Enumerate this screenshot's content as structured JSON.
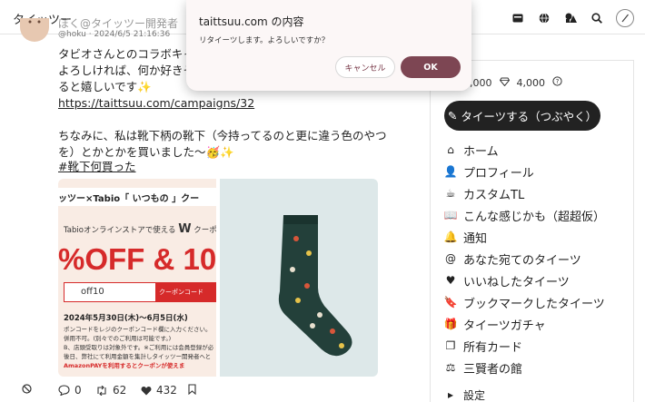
{
  "app": {
    "brand": "タイッツー"
  },
  "colors": {
    "dialog_ok": "#7d4653",
    "dialog_bg": "#fcf7f7",
    "primary_button": "#222222",
    "promo_red": "#d62a2a",
    "sock_panel": "#dde8e9"
  },
  "topbar": {
    "icons": [
      "card-icon",
      "globe-icon",
      "shapes-icon",
      "search-icon",
      "pen-icon"
    ]
  },
  "post": {
    "author": "ぼく@タイッツー開発者",
    "handle": "@hoku",
    "timestamp": "2024/6/5 21:16:36",
    "lines": [
      "タビオさんとのコラボキャン",
      "よろしければ、何か好きそ",
      "ると嬉しいです✨"
    ],
    "link": "https://taittsuu.com/campaigns/32",
    "lines2": [
      "ちなみに、私は靴下柄の靴下（今持ってるのと更に違う色のやつ",
      "を）とかとかを買いました〜🥳✨"
    ],
    "hashtag": "#靴下何買った"
  },
  "promo": {
    "strip": "ッツー×Tabio「 いつもの 」クー",
    "sub_prefix": "Tabioオンラインストアで使える",
    "sub_w": "W",
    "sub_suffix": "クーポン",
    "off_text": "%OFF & 10",
    "code": "off10",
    "tag": "クーポンコード",
    "date": "2024年5月30日(木)～6月5日(水)",
    "fine1": "ポンコードをレジのクーポンコード欄に入力ください。",
    "fine2": "併用不可。(別々でのご利用は可能です。)",
    "fine3": "B、店頭受取りは対象外です。※ご利用には会員登録が必",
    "fine4": "後日、弊社にて利用金額を集計しタイッツー開発者へと",
    "fine5": "AmazonPAYを利用するとクーポンが使えま"
  },
  "actions": {
    "replies": "0",
    "retweets": "62",
    "likes": "432"
  },
  "sidebar": {
    "stat1": "4,000",
    "stat2": "4,000",
    "post_button": "タイーツする（つぶやく）",
    "items": [
      {
        "label": "ホーム",
        "icon": "home-icon",
        "glyph": "⌂"
      },
      {
        "label": "プロフィール",
        "icon": "user-icon",
        "glyph": "👤"
      },
      {
        "label": "カスタムTL",
        "icon": "cup-icon",
        "glyph": "☕"
      },
      {
        "label": "こんな感じかも（超超仮）",
        "icon": "book-icon",
        "glyph": "📖"
      },
      {
        "label": "通知",
        "icon": "bell-icon",
        "glyph": "🔔"
      },
      {
        "label": "あなた宛てのタイーツ",
        "icon": "at-icon",
        "glyph": "@"
      },
      {
        "label": "いいねしたタイーツ",
        "icon": "heart-icon",
        "glyph": "♥"
      },
      {
        "label": "ブックマークしたタイーツ",
        "icon": "bookmark-icon",
        "glyph": "🔖"
      },
      {
        "label": "タイーツガチャ",
        "icon": "gift-icon",
        "glyph": "🎁"
      },
      {
        "label": "所有カード",
        "icon": "cards-icon",
        "glyph": "❐"
      },
      {
        "label": "三賢者の館",
        "icon": "scales-icon",
        "glyph": "⚖"
      }
    ],
    "settings": "設定"
  },
  "dialog": {
    "title": "taittsuu.com の内容",
    "message": "リタイーツします。よろしいですか？",
    "cancel": "キャンセル",
    "ok": "OK"
  }
}
